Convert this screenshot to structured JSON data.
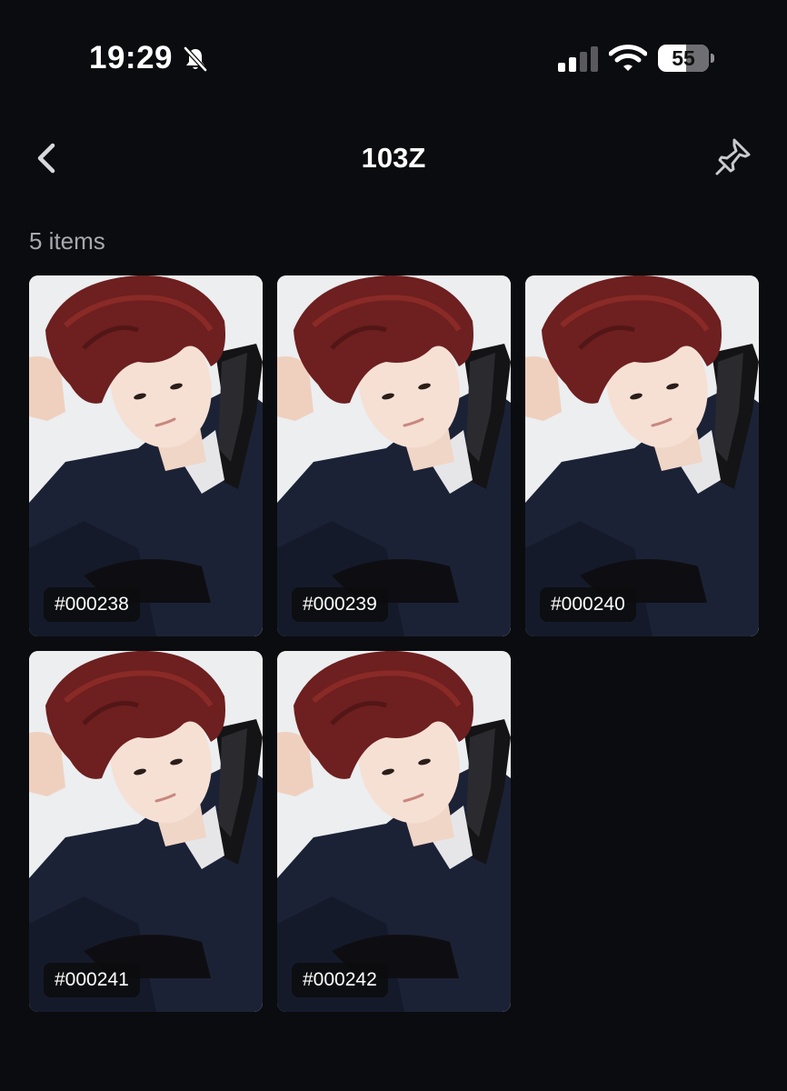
{
  "status_bar": {
    "time": "19:29",
    "battery": "55",
    "battery_level": 0.55
  },
  "header": {
    "title": "103Z"
  },
  "list": {
    "count_label": "5 items",
    "items": [
      {
        "id": "#000238"
      },
      {
        "id": "#000239"
      },
      {
        "id": "#000240"
      },
      {
        "id": "#000241"
      },
      {
        "id": "#000242"
      }
    ]
  },
  "icons": {
    "status": [
      "bell-slash-icon",
      "cellular-signal-icon",
      "wifi-icon",
      "battery-icon"
    ],
    "header": [
      "chevron-left-icon",
      "pin-icon"
    ]
  },
  "colors": {
    "background": "#0b0c0f",
    "text": "#ffffff",
    "muted": "#a7a9ae",
    "tag_bg": "#0c0c0e"
  }
}
